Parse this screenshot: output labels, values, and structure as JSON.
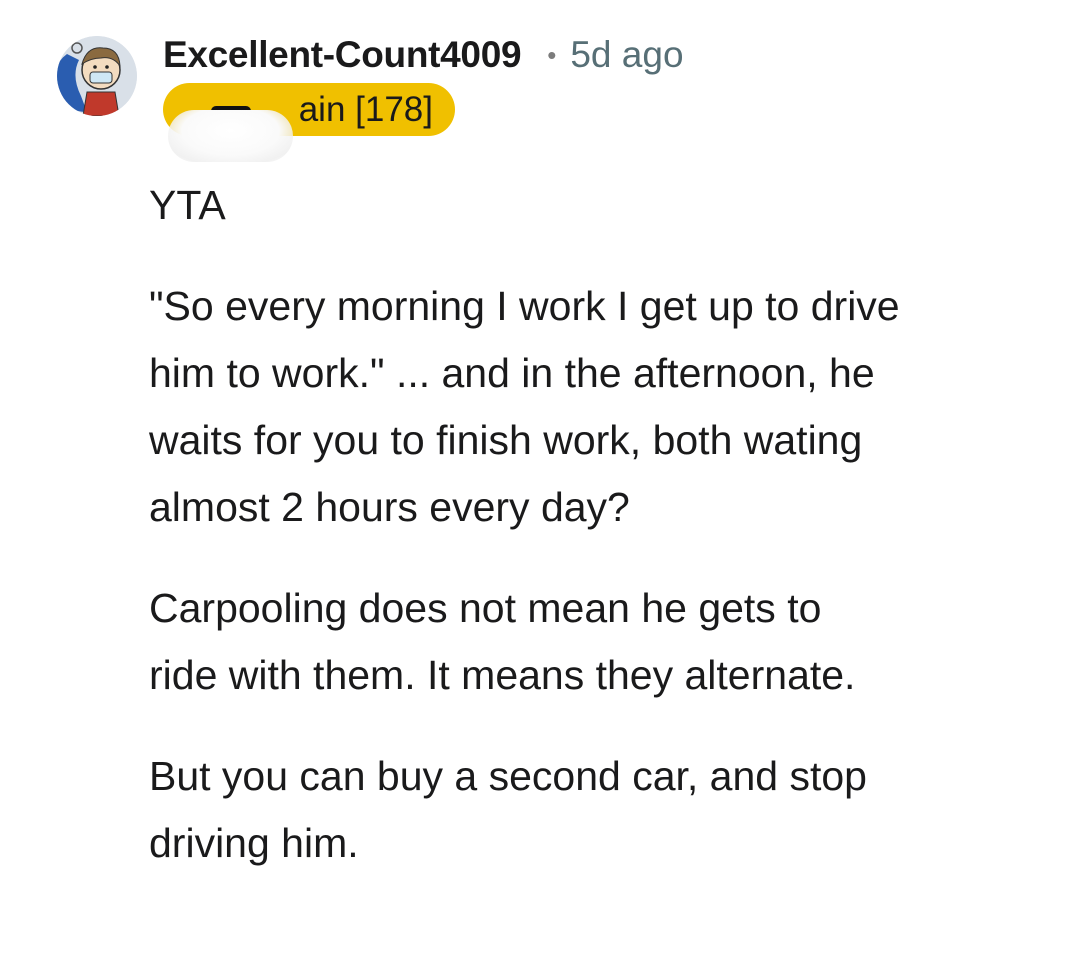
{
  "comment": {
    "username": "Excellent-Count4009",
    "separator": "•",
    "timestamp": "5d ago",
    "flair": "ain [178]",
    "paragraphs": [
      "YTA",
      "\"So every morning I work I get up to drive\nhim to work.\" ... and in the afternoon, he\nwaits for you to finish work, both wating\nalmost 2 hours every day?",
      "Carpooling does not mean he gets to\nride with them. It means they alternate.",
      "But you can buy a second car, and stop\ndriving him."
    ]
  },
  "colors": {
    "flair_background": "#f0c000",
    "timestamp": "#576f76",
    "text": "#1a1a1b"
  },
  "icons": {
    "avatar": "user-avatar-icon"
  }
}
